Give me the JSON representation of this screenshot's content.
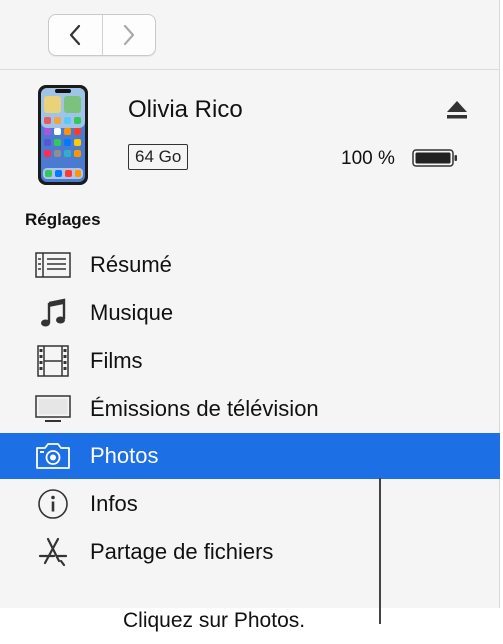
{
  "device": {
    "name": "Olivia Rico",
    "capacity": "64 Go",
    "battery": "100 %"
  },
  "sidebar": {
    "title": "Réglages",
    "items": [
      {
        "label": "Résumé",
        "icon": "summary-list-icon"
      },
      {
        "label": "Musique",
        "icon": "music-note-icon"
      },
      {
        "label": "Films",
        "icon": "film-strip-icon"
      },
      {
        "label": "Émissions de télévision",
        "icon": "tv-icon"
      },
      {
        "label": "Photos",
        "icon": "camera-icon",
        "selected": true
      },
      {
        "label": "Infos",
        "icon": "info-icon"
      },
      {
        "label": "Partage de fichiers",
        "icon": "app-store-icon"
      }
    ]
  },
  "callout": "Cliquez sur Photos.",
  "colors": {
    "selection": "#1d6fe6",
    "panel": "#f5f5f5"
  }
}
